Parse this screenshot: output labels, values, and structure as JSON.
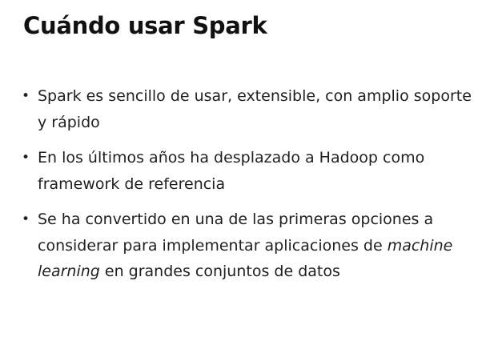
{
  "slide": {
    "title": "Cuándo usar Spark",
    "bullet_symbol": "•",
    "bullets": [
      {
        "text": "Spark es sencillo de usar, extensible, con amplio soporte y rápido"
      },
      {
        "text": "En los últimos años ha desplazado a Hadoop como framework de referencia"
      },
      {
        "text_before": "Se ha convertido en una de las primeras opciones a considerar para implementar aplicaciones de ",
        "text_emphasis": "machine learning",
        "text_after": " en grandes conjuntos de datos"
      }
    ]
  }
}
